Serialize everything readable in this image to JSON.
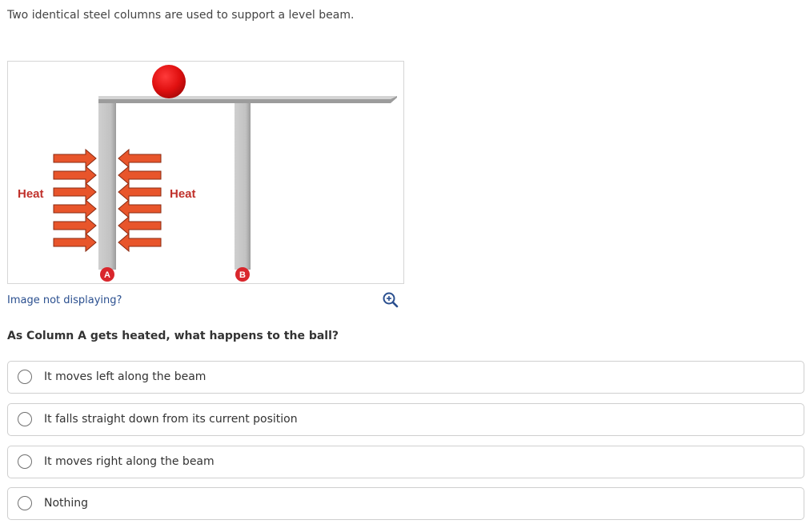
{
  "intro_text": "Two identical steel columns are used to support a level beam.",
  "figure": {
    "heat_label_left": "Heat",
    "heat_label_right": "Heat",
    "column_a_label": "A",
    "column_b_label": "B",
    "colors": {
      "ball": "#e01010",
      "arrow": "#e8552b",
      "badge": "#d9262c",
      "heat_text": "#c0312b"
    }
  },
  "image_help_link": "Image not displaying?",
  "zoom_icon": "zoom-in-icon",
  "question": "As Column A gets heated, what happens to the ball?",
  "options": [
    {
      "label": "It moves left along the beam"
    },
    {
      "label": "It falls straight down from its current position"
    },
    {
      "label": "It moves right along the beam"
    },
    {
      "label": "Nothing"
    }
  ]
}
